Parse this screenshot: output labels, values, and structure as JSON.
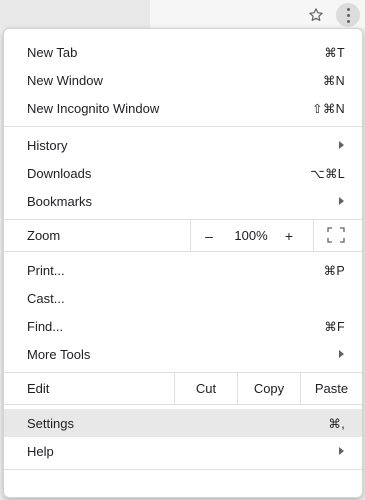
{
  "toolbar": {
    "bookmark_icon": "star-icon",
    "menu_icon": "kebab-menu-icon"
  },
  "menu": {
    "group1": [
      {
        "label": "New Tab",
        "shortcut": "⌘T"
      },
      {
        "label": "New Window",
        "shortcut": "⌘N"
      },
      {
        "label": "New Incognito Window",
        "shortcut": "⇧⌘N"
      }
    ],
    "group2": [
      {
        "label": "History",
        "submenu": true
      },
      {
        "label": "Downloads",
        "shortcut": "⌥⌘L"
      },
      {
        "label": "Bookmarks",
        "submenu": true
      }
    ],
    "zoom": {
      "label": "Zoom",
      "minus": "–",
      "value": "100%",
      "plus": "+",
      "fullscreen_icon": "fullscreen-icon"
    },
    "group3": [
      {
        "label": "Print...",
        "shortcut": "⌘P"
      },
      {
        "label": "Cast..."
      },
      {
        "label": "Find...",
        "shortcut": "⌘F"
      },
      {
        "label": "More Tools",
        "submenu": true
      }
    ],
    "edit": {
      "label": "Edit",
      "cut": "Cut",
      "copy": "Copy",
      "paste": "Paste"
    },
    "group4": [
      {
        "label": "Settings",
        "shortcut": "⌘,",
        "highlighted": true
      },
      {
        "label": "Help",
        "submenu": true
      }
    ]
  }
}
